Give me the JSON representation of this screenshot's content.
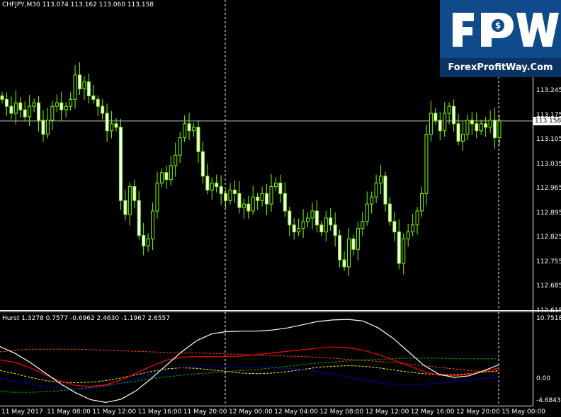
{
  "header": {
    "symbol_info": "CHFJPY,M30",
    "ohlc": "113.074 113.162 113.060 113.158"
  },
  "current_price": "113.158",
  "price_axis": {
    "ticks": [
      "113.245",
      "113.175",
      "113.105",
      "113.035",
      "112.965",
      "112.895",
      "112.825",
      "112.755",
      "112.685",
      "112.615"
    ]
  },
  "indicator": {
    "label": "Hurst 1.3278 0.7577 -0.6962 2.4630 -1.1967 2.6557",
    "axis_ticks": [
      "10.7518",
      "0.00",
      "-4.6843"
    ]
  },
  "time_axis": {
    "ticks": [
      "11 May 2017",
      "11 May 08:00",
      "11 May 12:00",
      "11 May 16:00",
      "11 May 20:00",
      "12 May 00:00",
      "12 May 04:00",
      "12 May 08:00",
      "12 May 12:00",
      "12 May 16:00",
      "12 May 20:00",
      "15 May 00:00"
    ]
  },
  "logo": {
    "letters": "FPW",
    "subtitle": "ForexProfitWay.Com"
  },
  "colors": {
    "background": "#000000",
    "candle": "#7CFC00",
    "bear_candle_body": "#ffffff",
    "grid_line": "#ffffff",
    "hurst_white": "#ffffff",
    "hurst_red": "#ff0000",
    "hurst_blue": "#0000ff",
    "hurst_yellow": "#ffff00",
    "hurst_green": "#00aa00",
    "hurst_orange_dash": "#ff4500",
    "logo_blue": "#0f4a8b"
  },
  "chart_data": [
    {
      "type": "candlestick",
      "title": "CHFJPY,M30",
      "ylim": [
        112.61,
        113.3
      ],
      "x_ticks": [
        "11 May 2017",
        "11 May 08:00",
        "11 May 12:00",
        "11 May 16:00",
        "11 May 20:00",
        "12 May 00:00",
        "12 May 04:00",
        "12 May 08:00",
        "12 May 12:00",
        "12 May 16:00",
        "12 May 20:00",
        "15 May 00:00"
      ],
      "last_close": 113.158,
      "approx_closes": [
        113.22,
        113.2,
        113.18,
        113.21,
        113.19,
        113.17,
        113.2,
        113.21,
        113.16,
        113.12,
        113.16,
        113.2,
        113.21,
        113.19,
        113.2,
        113.22,
        113.29,
        113.25,
        113.27,
        113.23,
        113.22,
        113.2,
        113.18,
        113.13,
        113.15,
        113.14,
        112.93,
        112.89,
        112.97,
        112.93,
        112.83,
        112.8,
        112.82,
        112.9,
        112.98,
        113.01,
        112.99,
        113.03,
        113.06,
        113.11,
        113.15,
        113.13,
        113.14,
        113.07,
        113.0,
        112.96,
        112.98,
        112.97,
        112.95,
        112.93,
        112.96,
        112.95,
        112.91,
        112.92,
        112.9,
        112.94,
        112.93,
        112.95,
        112.92,
        112.97,
        112.98,
        112.95,
        112.9,
        112.86,
        112.84,
        112.85,
        112.87,
        112.88,
        112.9,
        112.86,
        112.84,
        112.88,
        112.86,
        112.83,
        112.76,
        112.74,
        112.82,
        112.79,
        112.85,
        112.87,
        112.92,
        112.94,
        112.98,
        113.0,
        112.92,
        112.87,
        112.84,
        112.75,
        112.82,
        112.84,
        112.86,
        112.9,
        112.95,
        113.12,
        113.18,
        113.16,
        113.13,
        113.18,
        113.2,
        113.15,
        113.1,
        113.12,
        113.16,
        113.15,
        113.13,
        113.15,
        113.14,
        113.16,
        113.11,
        113.158
      ],
      "horizontal_line": 113.158,
      "vertical_markers": [
        "12 May 00:00",
        "15 May 00:00"
      ]
    },
    {
      "type": "line",
      "title": "Hurst 1.3278 0.7577 -0.6962 2.4630 -1.1967 2.6557",
      "ylim": [
        -4.6843,
        10.7518
      ],
      "y_ticks": [
        10.7518,
        0.0,
        -4.6843
      ],
      "series": [
        {
          "color": "#ffffff",
          "values": [
            5.5,
            4.2,
            2.5,
            0.5,
            -1.5,
            -3.2,
            -4.5,
            -5.0,
            -4.4,
            -2.8,
            -0.5,
            2.0,
            4.5,
            6.6,
            7.9,
            8.3,
            8.4,
            8.4,
            8.6,
            9.0,
            9.6,
            10.2,
            10.5,
            10.6,
            10.3,
            9.0,
            7.0,
            4.5,
            2.0,
            0.3,
            -0.3,
            0.0,
            1.0,
            2.1
          ]
        },
        {
          "color": "#ff0000",
          "values": [
            3.0,
            2.5,
            1.5,
            0.2,
            -1.0,
            -1.8,
            -2.0,
            -1.7,
            -0.8,
            0.5,
            1.8,
            2.9,
            3.5,
            3.6,
            3.6,
            3.6,
            3.7,
            4.0,
            4.3,
            4.6,
            4.9,
            5.2,
            5.4,
            5.3,
            4.8,
            4.0,
            3.0,
            1.9,
            0.8,
            0.1,
            0.0,
            0.3,
            0.9,
            1.5
          ]
        },
        {
          "color": "#0000ff",
          "values": [
            -0.5,
            -1.0,
            -1.5,
            -2.0,
            -2.3,
            -2.5,
            -2.4,
            -2.0,
            -1.4,
            -0.6,
            0.3,
            1.0,
            1.5,
            1.7,
            1.7,
            1.6,
            1.5,
            1.5,
            1.5,
            1.4,
            1.2,
            0.8,
            0.3,
            -0.2,
            -0.8,
            -1.3,
            -1.6,
            -1.7,
            -1.6,
            -1.4,
            -1.1,
            -0.8,
            -0.5,
            -0.2
          ]
        },
        {
          "color": "#ffff00",
          "values": [
            1.0,
            0.4,
            -0.3,
            -0.9,
            -1.2,
            -1.3,
            -1.2,
            -0.9,
            -0.4,
            0.2,
            0.8,
            1.3,
            1.5,
            1.4,
            1.1,
            0.8,
            0.5,
            0.4,
            0.5,
            0.8,
            1.2,
            1.6,
            1.8,
            1.9,
            1.8,
            1.5,
            1.1,
            0.7,
            0.4,
            0.2,
            0.2,
            0.4,
            0.7,
            1.0
          ]
        },
        {
          "color": "#00aa00",
          "values": [
            -3.0,
            -3.1,
            -3.1,
            -3.0,
            -2.8,
            -2.5,
            -2.2,
            -1.8,
            -1.4,
            -1.0,
            -0.6,
            -0.2,
            0.1,
            0.4,
            0.6,
            0.8,
            1.0,
            1.2,
            1.5,
            1.8,
            2.1,
            2.4,
            2.6,
            2.8,
            3.0,
            3.1,
            3.2,
            3.3,
            3.3,
            3.3,
            3.2,
            3.2,
            3.2,
            3.2
          ]
        },
        {
          "color": "#ff4500",
          "values": [
            4.5,
            4.8,
            5.0,
            5.0,
            5.0,
            5.0,
            4.9,
            4.8,
            4.7,
            4.6,
            4.5,
            4.4,
            4.3,
            4.3,
            4.2,
            4.1,
            4.0,
            3.9,
            3.8,
            3.7,
            3.6,
            3.5,
            3.3,
            3.1,
            2.9,
            2.7,
            2.5,
            2.2,
            1.9,
            1.6,
            1.3,
            1.0,
            0.8,
            0.7
          ]
        }
      ]
    }
  ]
}
